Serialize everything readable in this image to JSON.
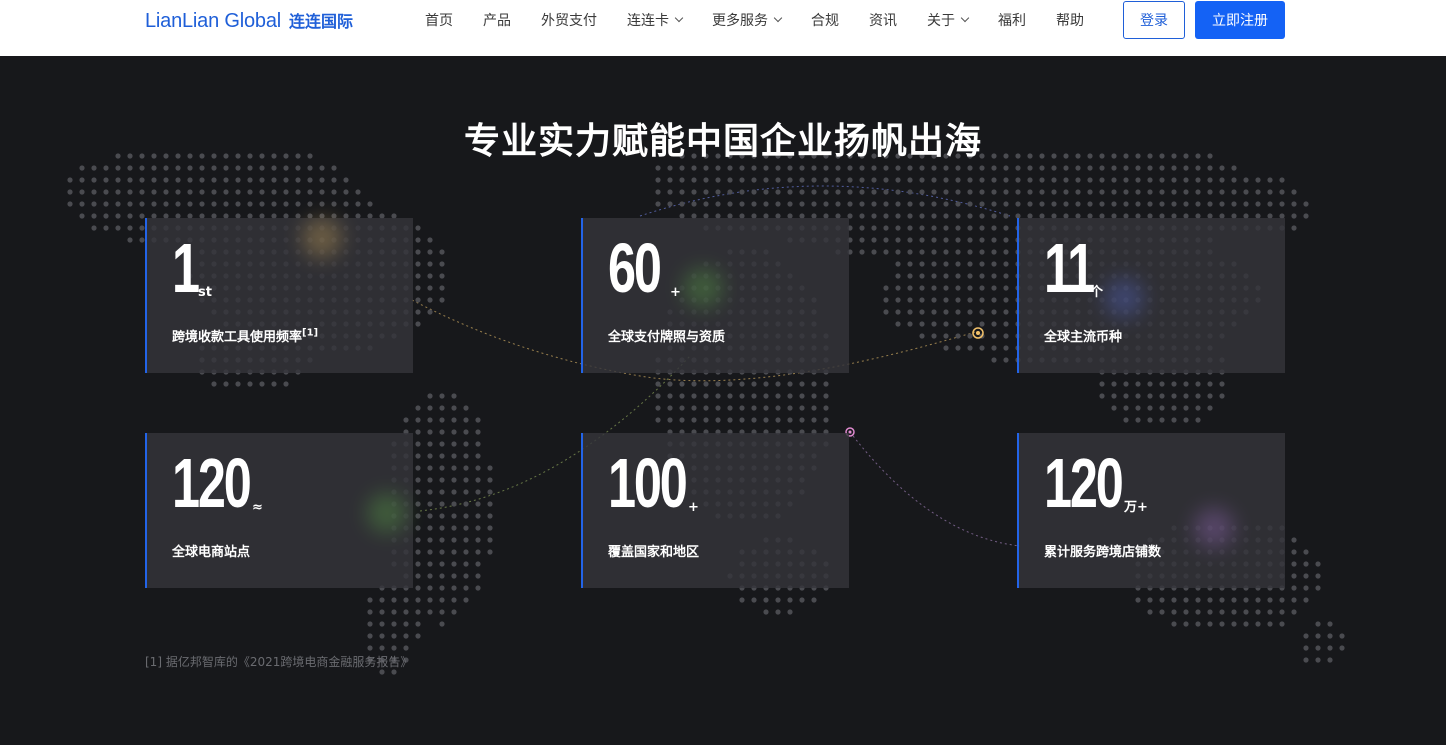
{
  "header": {
    "logo_en": "LianLian Global",
    "logo_cn": "连连国际",
    "nav": [
      {
        "label": "首页",
        "dropdown": false
      },
      {
        "label": "产品",
        "dropdown": false
      },
      {
        "label": "外贸支付",
        "dropdown": false
      },
      {
        "label": "连连卡",
        "dropdown": true
      },
      {
        "label": "更多服务",
        "dropdown": true
      },
      {
        "label": "合规",
        "dropdown": false
      },
      {
        "label": "资讯",
        "dropdown": false
      },
      {
        "label": "关于",
        "dropdown": true
      },
      {
        "label": "福利",
        "dropdown": false
      },
      {
        "label": "帮助",
        "dropdown": false
      }
    ],
    "login_label": "登录",
    "register_label": "立即注册"
  },
  "hero": {
    "title": "专业实力赋能中国企业扬帆出海",
    "stats": [
      {
        "value": "1",
        "suffix": "st",
        "label": "跨境收款工具使用频率",
        "note": "[1]"
      },
      {
        "value": "60",
        "suffix": "+",
        "label": "全球支付牌照与资质",
        "note": ""
      },
      {
        "value": "11",
        "suffix": "个",
        "label": "全球主流币种",
        "note": ""
      },
      {
        "value": "120",
        "suffix": "≈",
        "label": "全球电商站点",
        "note": ""
      },
      {
        "value": "100",
        "suffix": "+",
        "label": "覆盖国家和地区",
        "note": ""
      },
      {
        "value": "120",
        "suffix": "万+",
        "label": "累计服务跨境店铺数",
        "note": ""
      }
    ],
    "footnote": "[1] 据亿邦智库的《2021跨境电商金融服务报告》"
  },
  "colors": {
    "brand_blue": "#1f5fd8",
    "register_blue": "#1462f5",
    "background": "#17181b",
    "card_border": "#2364e8"
  }
}
